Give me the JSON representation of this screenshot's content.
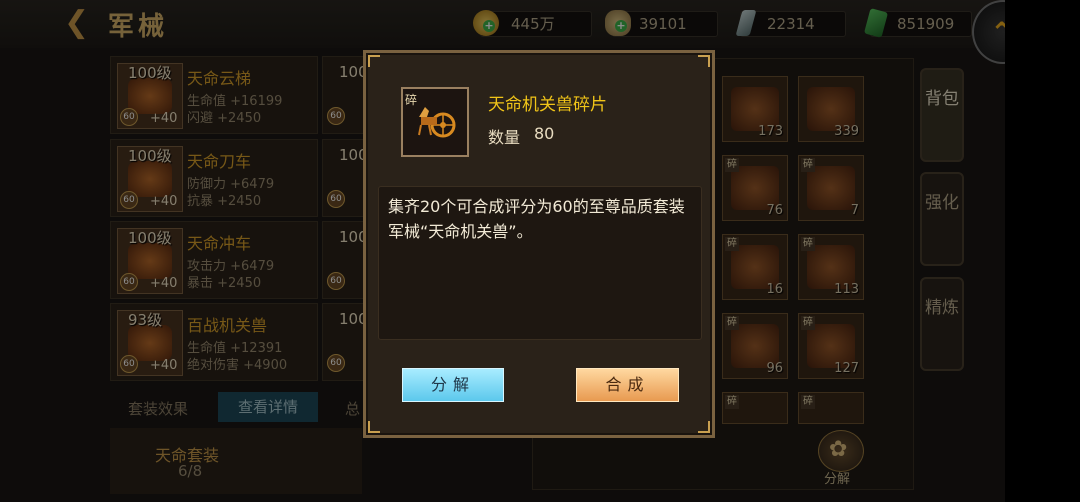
{
  "header": {
    "title": "军械"
  },
  "resources": [
    {
      "name": "gold",
      "value": "445万",
      "icon": "gold-coin-plus-icon",
      "color": "#d8b030"
    },
    {
      "name": "silver",
      "value": "39101",
      "icon": "silver-ingot-plus-icon",
      "color": "#c8b070"
    },
    {
      "name": "crystal",
      "value": "22314",
      "icon": "crystal-icon",
      "color": "#a0b8b8"
    },
    {
      "name": "jade",
      "value": "851909",
      "icon": "jade-icon",
      "color": "#3a9a40"
    }
  ],
  "equipment_list": [
    {
      "level": "100级",
      "name": "天命云梯",
      "stat1": "生命值 +16199",
      "stat2": "闪避 +2450",
      "quality": "60",
      "bonus": "+40"
    },
    {
      "level": "100级",
      "name": "天命刀车",
      "stat1": "防御力 +6479",
      "stat2": "抗暴 +2450",
      "quality": "60",
      "bonus": "+40"
    },
    {
      "level": "100级",
      "name": "天命冲车",
      "stat1": "攻击力 +6479",
      "stat2": "暴击 +2450",
      "quality": "60",
      "bonus": "+40"
    },
    {
      "level": "93级",
      "name": "百战机关兽",
      "stat1": "生命值 +12391",
      "stat2": "绝对伤害 +4900",
      "quality": "60",
      "bonus": "+40"
    }
  ],
  "equipment_list_col2": [
    {
      "level": "100",
      "quality": "60"
    },
    {
      "level": "100",
      "quality": "60"
    },
    {
      "level": "100",
      "quality": "60"
    },
    {
      "level": "100",
      "quality": "60"
    }
  ],
  "bottom_tabs": {
    "set_effect": "套装效果",
    "view_detail": "查看详情",
    "third": "总"
  },
  "set_info": {
    "name": "天命套装",
    "count": "6/8"
  },
  "inventory": [
    {
      "badge": "",
      "count": "173"
    },
    {
      "badge": "",
      "count": "339"
    },
    {
      "badge": "碎",
      "count": "76"
    },
    {
      "badge": "碎",
      "count": "7"
    },
    {
      "badge": "碎",
      "count": "16"
    },
    {
      "badge": "碎",
      "count": "113"
    },
    {
      "badge": "碎",
      "count": "96"
    },
    {
      "badge": "碎",
      "count": "127"
    },
    {
      "badge": "碎",
      "count": ""
    },
    {
      "badge": "碎",
      "count": ""
    }
  ],
  "side_tabs": {
    "bag": "背包",
    "enhance": "强化",
    "refine": "精炼"
  },
  "decompose_footer": "分解",
  "dialog": {
    "item_badge": "碎",
    "item_name": "天命机关兽碎片",
    "qty_label": "数量",
    "qty_value": "80",
    "description": "集齐20个可合成评分为60的至尊品质套装军械“天命机关兽”。",
    "decompose_label": "分解",
    "compose_label": "合成"
  }
}
